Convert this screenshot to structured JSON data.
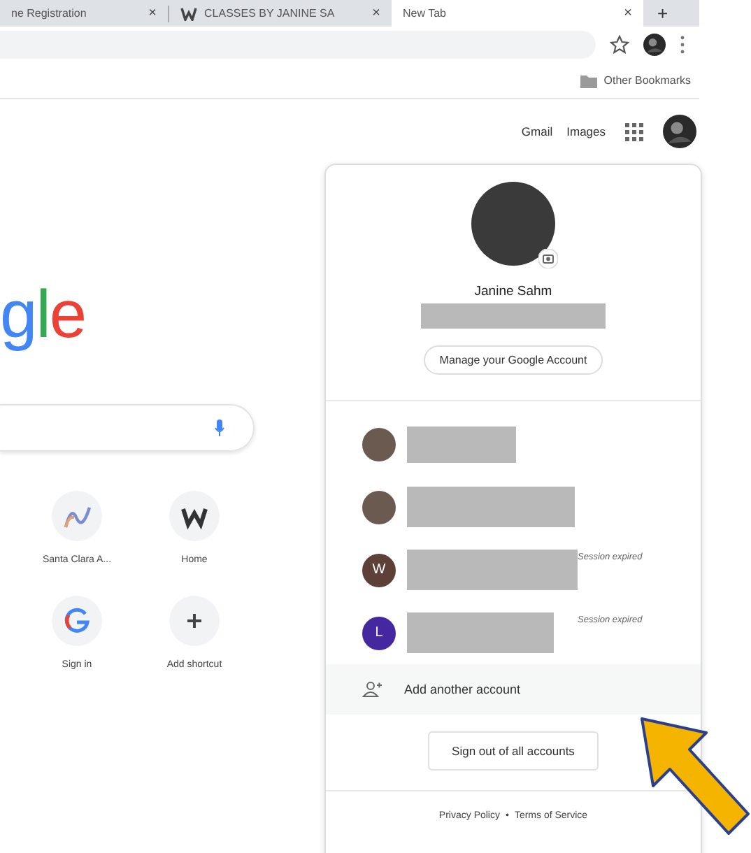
{
  "tabs": [
    {
      "title": "ne Registration",
      "close": "×",
      "selected": false,
      "icon": false
    },
    {
      "title": "CLASSES BY JANINE SA",
      "close": "×",
      "selected": false,
      "icon": true
    },
    {
      "title": "New Tab",
      "close": "×",
      "selected": true,
      "icon": false
    }
  ],
  "new_tab": "+",
  "bookmarks": [
    "Other Bookmarks"
  ],
  "header_links": [
    "Gmail",
    "Images"
  ],
  "logo": "gle",
  "shortcuts": [
    {
      "label": "Santa Clara A...",
      "kind": "script"
    },
    {
      "label": "Home",
      "kind": "w"
    },
    {
      "label": "Sign in",
      "kind": "g"
    },
    {
      "label": "Add shortcut",
      "kind": "add"
    }
  ],
  "account": {
    "name": "Janine Sahm",
    "manage": "Manage your Google Account",
    "others": [
      {
        "kind": "photo"
      },
      {
        "kind": "photo"
      },
      {
        "kind": "letter",
        "letter": "W",
        "color": "#5d4037",
        "status": "Session expired"
      },
      {
        "kind": "letter",
        "letter": "L",
        "color": "#4527a0",
        "status": "Session expired"
      }
    ],
    "add": "Add another account",
    "sign_out": "Sign out of all accounts",
    "footer": [
      "Privacy Policy",
      "Terms of Service"
    ],
    "footer_sep": "•"
  }
}
